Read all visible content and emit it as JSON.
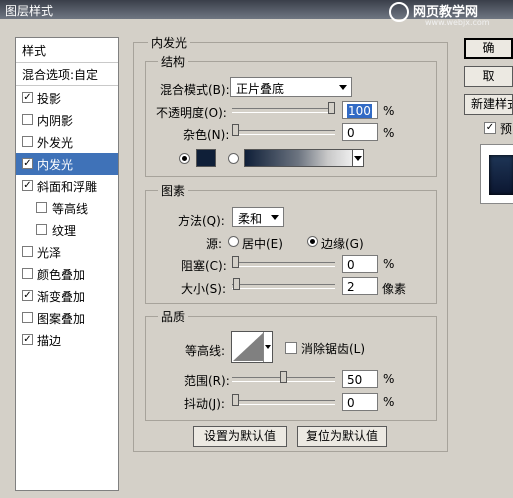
{
  "window": {
    "title": "图层样式",
    "watermark_title": "网页教学网",
    "watermark_url": "www.webjx.com"
  },
  "sidebar": {
    "header": "样式",
    "blend": "混合选项:自定",
    "items": [
      {
        "label": "投影",
        "checked": true
      },
      {
        "label": "内阴影",
        "checked": false
      },
      {
        "label": "外发光",
        "checked": false
      },
      {
        "label": "内发光",
        "checked": true,
        "selected": true
      },
      {
        "label": "斜面和浮雕",
        "checked": true
      },
      {
        "label": "等高线",
        "checked": false,
        "indent": true
      },
      {
        "label": "纹理",
        "checked": false,
        "indent": true
      },
      {
        "label": "光泽",
        "checked": false
      },
      {
        "label": "颜色叠加",
        "checked": false
      },
      {
        "label": "渐变叠加",
        "checked": true
      },
      {
        "label": "图案叠加",
        "checked": false
      },
      {
        "label": "描边",
        "checked": true
      }
    ]
  },
  "main": {
    "title": "内发光",
    "structure": {
      "legend": "结构",
      "blend_mode_label": "混合模式(B):",
      "blend_mode_value": "正片叠底",
      "opacity_label": "不透明度(O):",
      "opacity_value": "100",
      "opacity_unit": "%",
      "opacity_level": 1.0,
      "noise_label": "杂色(N):",
      "noise_value": "0",
      "noise_unit": "%",
      "noise_level": 0.0,
      "color_swatch": "#0f1f38"
    },
    "elements": {
      "legend": "图素",
      "method_label": "方法(Q):",
      "method_value": "柔和",
      "source_label": "源:",
      "source_center": "居中(E)",
      "source_edge": "边缘(G)",
      "choke_label": "阻塞(C):",
      "choke_value": "0",
      "choke_unit": "%",
      "choke_level": 0.0,
      "size_label": "大小(S):",
      "size_value": "2",
      "size_unit": "像素",
      "size_level": 0.01
    },
    "quality": {
      "legend": "品质",
      "contour_label": "等高线:",
      "antialias_label": "消除锯齿(L)",
      "range_label": "范围(R):",
      "range_value": "50",
      "range_unit": "%",
      "range_level": 0.5,
      "jitter_label": "抖动(J):",
      "jitter_value": "0",
      "jitter_unit": "%",
      "jitter_level": 0.0
    },
    "buttons": {
      "set_default": "设置为默认值",
      "reset_default": "复位为默认值"
    }
  },
  "right": {
    "ok": "确",
    "cancel": "取",
    "new_style": "新建样式",
    "preview": "预"
  }
}
